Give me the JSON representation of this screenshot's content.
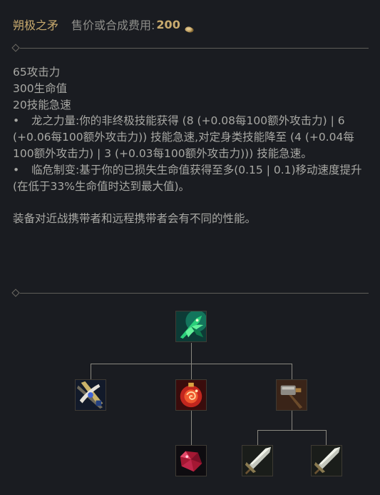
{
  "header": {
    "item_name": "朔极之矛",
    "price_label": "售价或合成费用:",
    "price_value": "200",
    "gold_icon": "gold-coin-icon"
  },
  "description": {
    "stats": [
      "65攻击力",
      "300生命值",
      "20技能急速"
    ],
    "passives": [
      {
        "bullet": "•",
        "text": "龙之力量:你的非终极技能获得 (8 (+0.08每100额外攻击力) | 6 (+0.06每100额外攻击力)) 技能急速,对定身类技能降至 (4 (+0.04每100额外攻击力) | 3 (+0.03每100额外攻击力))) 技能急速。"
      },
      {
        "bullet": "•",
        "text": "临危制变:基于你的已损失生命值获得至多(0.15 | 0.1)移动速度提升 (在低于33%生命值时达到最大值)。"
      }
    ],
    "note": "装备对近战携带者和远程携带者会有不同的性能。"
  },
  "recipe_tree": {
    "root": {
      "icon": "green-dragon-spear-icon"
    },
    "components": [
      {
        "icon": "jeweled-pickaxe-sword-icon"
      },
      {
        "icon": "red-potion-orb-icon",
        "children": [
          {
            "icon": "ruby-crystal-icon"
          }
        ]
      },
      {
        "icon": "warhammer-icon",
        "children": [
          {
            "icon": "long-sword-icon"
          },
          {
            "icon": "long-sword-icon"
          }
        ]
      }
    ]
  }
}
